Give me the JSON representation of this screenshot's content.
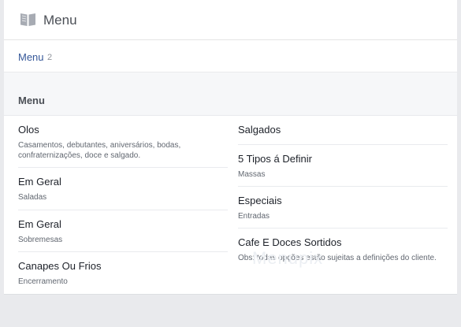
{
  "header": {
    "title": "Menu",
    "icon": "book-icon"
  },
  "breadcrumb": {
    "label": "Menu",
    "count": "2"
  },
  "section": {
    "title": "Menu"
  },
  "menu": {
    "left": [
      {
        "name": "Olos",
        "desc": "Casamentos, debutantes, aniversários, bodas, confraternizações, doce e salgado."
      },
      {
        "name": "Em Geral",
        "desc": "Saladas"
      },
      {
        "name": "Em Geral",
        "desc": "Sobremesas"
      },
      {
        "name": "Canapes Ou Frios",
        "desc": "Encerramento"
      }
    ],
    "right": [
      {
        "name": "Salgados",
        "desc": ""
      },
      {
        "name": "5 Tipos á Definir",
        "desc": "Massas"
      },
      {
        "name": "Especiais",
        "desc": "Entradas"
      },
      {
        "name": "Cafe E Doces Sortidos",
        "desc": "Obs: todas opções estão sujeitas a definições do cliente."
      }
    ]
  },
  "watermark": "Menupix",
  "colors": {
    "link": "#365899",
    "background": "#e9eaed",
    "panel": "#ffffff"
  }
}
